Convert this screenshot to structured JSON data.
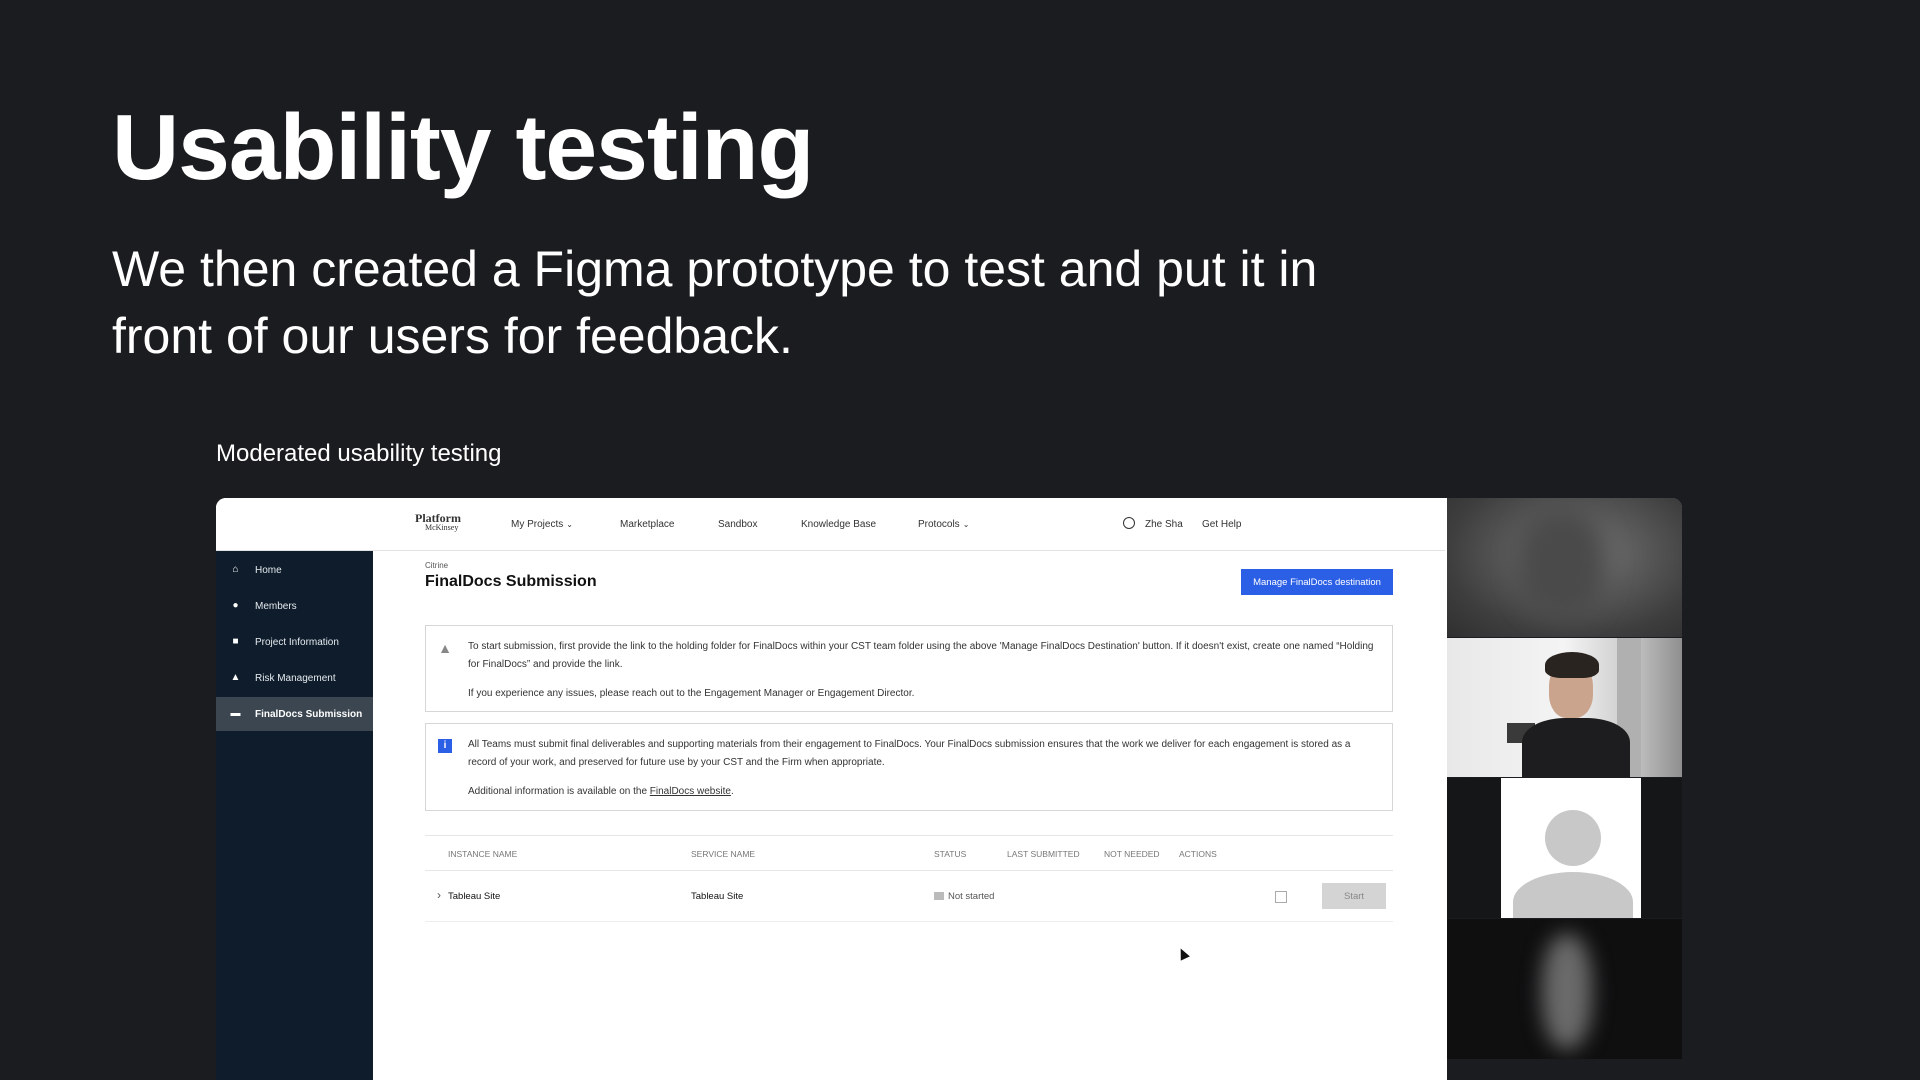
{
  "slide": {
    "title": "Usability testing",
    "subtitle": "We then created a Figma prototype to test and put it in front of our users for feedback.",
    "caption": "Moderated usability testing"
  },
  "app": {
    "logo": {
      "line1": "Platform",
      "line2": "McKinsey"
    },
    "nav": [
      {
        "label": "My Projects",
        "has_chevron": true
      },
      {
        "label": "Marketplace",
        "has_chevron": false
      },
      {
        "label": "Sandbox",
        "has_chevron": false
      },
      {
        "label": "Knowledge Base",
        "has_chevron": false
      },
      {
        "label": "Protocols",
        "has_chevron": true
      }
    ],
    "user": {
      "icon": "user-circle-icon",
      "name": "Zhe Sha"
    },
    "help_label": "Get Help",
    "sidebar": [
      {
        "label": "Home",
        "icon": "home-icon",
        "active": false
      },
      {
        "label": "Members",
        "icon": "members-icon",
        "active": false
      },
      {
        "label": "Project Information",
        "icon": "info-icon",
        "active": false
      },
      {
        "label": "Risk Management",
        "icon": "lock-icon",
        "active": false
      },
      {
        "label": "FinalDocs Submission",
        "icon": "folder-icon",
        "active": true
      }
    ],
    "breadcrumb": "Citrine",
    "page_title": "FinalDocs Submission",
    "manage_button": "Manage FinalDocs destination",
    "warning": {
      "icon": "warning-icon",
      "p1": "To start submission, first provide the link to the holding folder for FinalDocs within your CST team folder using the above 'Manage FinalDocs Destination' button. If it doesn't exist, create one named “Holding for FinalDocs” and provide the link.",
      "p2": "If you experience any issues, please reach out to the Engagement Manager or Engagement Director."
    },
    "info": {
      "icon": "info-icon",
      "icon_glyph": "i",
      "p1": "All Teams must submit final deliverables and supporting materials from their engagement to FinalDocs. Your FinalDocs submission ensures that the work we deliver for each engagement is stored as a record of your work, and preserved for future use by your CST and the Firm when appropriate.",
      "p2_prefix": "Additional information is available on the ",
      "p2_link": "FinalDocs website",
      "p2_suffix": "."
    },
    "table": {
      "headers": {
        "instance": "INSTANCE NAME",
        "service": "SERVICE NAME",
        "status": "STATUS",
        "last_submitted": "LAST SUBMITTED",
        "not_needed": "NOT NEEDED",
        "actions": "ACTIONS"
      },
      "rows": [
        {
          "instance": "Tableau Site",
          "service": "Tableau Site",
          "status": "Not started",
          "last_submitted": "",
          "not_needed": false,
          "action": "Start"
        }
      ]
    }
  },
  "colors": {
    "slide_bg": "#1b1c1f",
    "sidebar_bg": "#0e1c2b",
    "primary_button": "#2b5fe6",
    "disabled_button": "#d4d4d4"
  }
}
